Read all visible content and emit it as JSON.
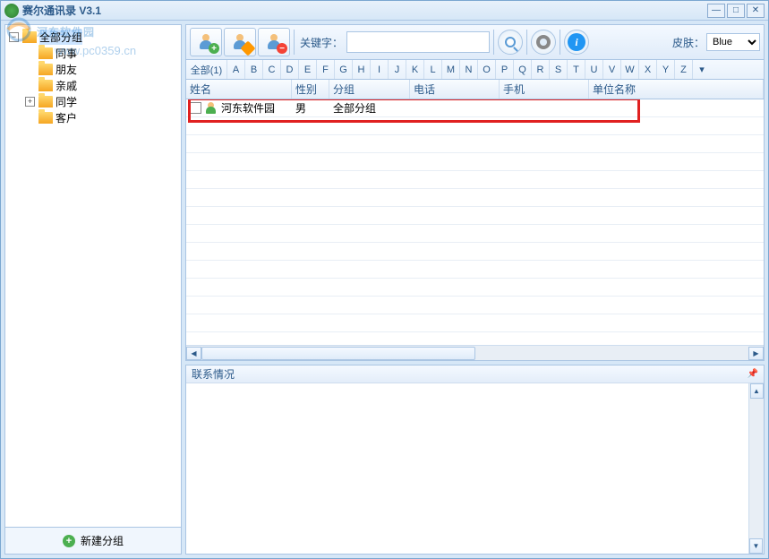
{
  "window": {
    "title": "赛尔通讯录 V3.1"
  },
  "watermark": {
    "text": "河东软件园",
    "url": "www.pc0359.cn"
  },
  "sidebar": {
    "root": "全部分组",
    "groups": [
      {
        "label": "同事",
        "expandable": false
      },
      {
        "label": "朋友",
        "expandable": false
      },
      {
        "label": "亲戚",
        "expandable": false
      },
      {
        "label": "同学",
        "expandable": true
      },
      {
        "label": "客户",
        "expandable": false
      }
    ],
    "new_group_label": "新建分组"
  },
  "toolbar": {
    "keyword_label": "关键字：",
    "skin_label": "皮肤：",
    "skin_value": "Blue"
  },
  "alpha_bar": {
    "all_label": "全部(1)",
    "letters": [
      "A",
      "B",
      "C",
      "D",
      "E",
      "F",
      "G",
      "H",
      "I",
      "J",
      "K",
      "L",
      "M",
      "N",
      "O",
      "P",
      "Q",
      "R",
      "S",
      "T",
      "U",
      "V",
      "W",
      "X",
      "Y",
      "Z"
    ]
  },
  "grid": {
    "columns": {
      "name": "姓名",
      "gender": "性别",
      "group": "分组",
      "phone": "电话",
      "mobile": "手机",
      "company": "单位名称"
    },
    "rows": [
      {
        "name": "河东软件园",
        "gender": "男",
        "group": "全部分组",
        "phone": "",
        "mobile": "",
        "company": ""
      }
    ]
  },
  "detail": {
    "title": "联系情况"
  }
}
